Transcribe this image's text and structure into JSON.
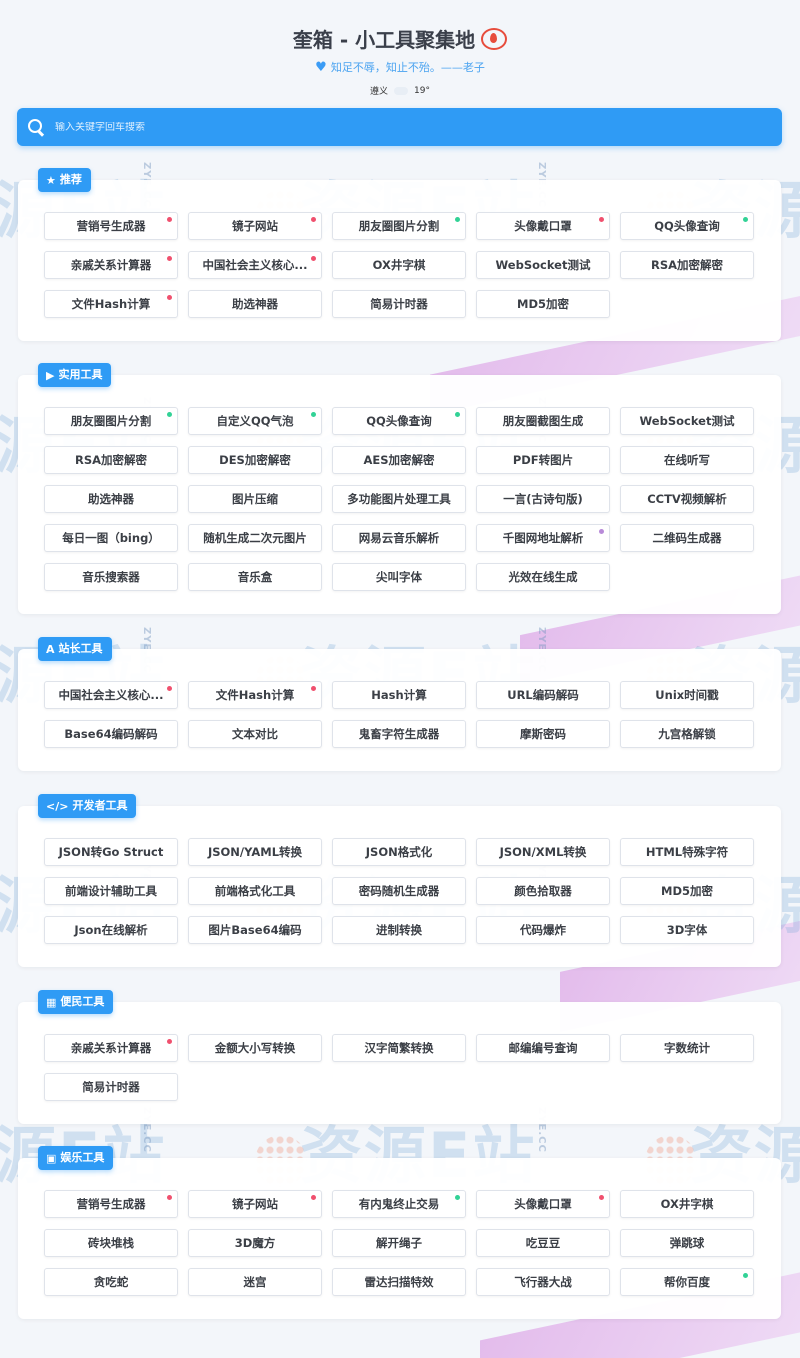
{
  "header": {
    "title": "奎箱 - 小工具聚集地",
    "subtitle": "知足不辱，知止不殆。——老子",
    "weather": {
      "city": "遵义",
      "temp": "19°"
    }
  },
  "search": {
    "placeholder": "输入关键字回车搜索"
  },
  "watermark": {
    "text": "资源E站",
    "small": "ZYE.CC"
  },
  "colors": {
    "accent": "#2f9bf5",
    "red_dot": "#f0506e",
    "green_dot": "#32d296",
    "purple_dot": "#b88ad8"
  },
  "sections": [
    {
      "key": "recommend",
      "title": "推荐",
      "icon": "star-icon",
      "tools": [
        {
          "label": "营销号生成器",
          "dot": "red"
        },
        {
          "label": "镜子网站",
          "dot": "red"
        },
        {
          "label": "朋友圈图片分割",
          "dot": "green"
        },
        {
          "label": "头像戴口罩",
          "dot": "red"
        },
        {
          "label": "QQ头像查询",
          "dot": "green"
        },
        {
          "label": "亲戚关系计算器",
          "dot": "red"
        },
        {
          "label": "中国社会主义核心...",
          "dot": "red"
        },
        {
          "label": "OX井字棋",
          "dot": ""
        },
        {
          "label": "WebSocket测试",
          "dot": ""
        },
        {
          "label": "RSA加密解密",
          "dot": ""
        },
        {
          "label": "文件Hash计算",
          "dot": "red"
        },
        {
          "label": "助选神器",
          "dot": ""
        },
        {
          "label": "简易计时器",
          "dot": ""
        },
        {
          "label": "MD5加密",
          "dot": ""
        }
      ]
    },
    {
      "key": "practical",
      "title": "实用工具",
      "icon": "play-circle-icon",
      "tools": [
        {
          "label": "朋友圈图片分割",
          "dot": "green"
        },
        {
          "label": "自定义QQ气泡",
          "dot": "green"
        },
        {
          "label": "QQ头像查询",
          "dot": "green"
        },
        {
          "label": "朋友圈截图生成",
          "dot": ""
        },
        {
          "label": "WebSocket测试",
          "dot": ""
        },
        {
          "label": "RSA加密解密",
          "dot": ""
        },
        {
          "label": "DES加密解密",
          "dot": ""
        },
        {
          "label": "AES加密解密",
          "dot": ""
        },
        {
          "label": "PDF转图片",
          "dot": ""
        },
        {
          "label": "在线听写",
          "dot": ""
        },
        {
          "label": "助选神器",
          "dot": ""
        },
        {
          "label": "图片压缩",
          "dot": ""
        },
        {
          "label": "多功能图片处理工具",
          "dot": ""
        },
        {
          "label": "一言(古诗句版)",
          "dot": ""
        },
        {
          "label": "CCTV视频解析",
          "dot": ""
        },
        {
          "label": "每日一图（bing）",
          "dot": ""
        },
        {
          "label": "随机生成二次元图片",
          "dot": ""
        },
        {
          "label": "网易云音乐解析",
          "dot": ""
        },
        {
          "label": "千图网地址解析",
          "dot": "purple"
        },
        {
          "label": "二维码生成器",
          "dot": ""
        },
        {
          "label": "音乐搜索器",
          "dot": ""
        },
        {
          "label": "音乐盒",
          "dot": ""
        },
        {
          "label": "尖叫字体",
          "dot": ""
        },
        {
          "label": "光效在线生成",
          "dot": ""
        }
      ]
    },
    {
      "key": "webmaster",
      "title": "站长工具",
      "icon": "font-a-icon",
      "tools": [
        {
          "label": "中国社会主义核心...",
          "dot": "red"
        },
        {
          "label": "文件Hash计算",
          "dot": "red"
        },
        {
          "label": "Hash计算",
          "dot": ""
        },
        {
          "label": "URL编码解码",
          "dot": ""
        },
        {
          "label": "Unix时间戳",
          "dot": ""
        },
        {
          "label": "Base64编码解码",
          "dot": ""
        },
        {
          "label": "文本对比",
          "dot": ""
        },
        {
          "label": "鬼畜字符生成器",
          "dot": ""
        },
        {
          "label": "摩斯密码",
          "dot": ""
        },
        {
          "label": "九宫格解锁",
          "dot": ""
        }
      ]
    },
    {
      "key": "developer",
      "title": "开发者工具",
      "icon": "code-icon",
      "tools": [
        {
          "label": "JSON转Go Struct",
          "dot": ""
        },
        {
          "label": "JSON/YAML转换",
          "dot": ""
        },
        {
          "label": "JSON格式化",
          "dot": ""
        },
        {
          "label": "JSON/XML转换",
          "dot": ""
        },
        {
          "label": "HTML特殊字符",
          "dot": ""
        },
        {
          "label": "前端设计辅助工具",
          "dot": ""
        },
        {
          "label": "前端格式化工具",
          "dot": ""
        },
        {
          "label": "密码随机生成器",
          "dot": ""
        },
        {
          "label": "颜色拾取器",
          "dot": ""
        },
        {
          "label": "MD5加密",
          "dot": ""
        },
        {
          "label": "Json在线解析",
          "dot": ""
        },
        {
          "label": "图片Base64编码",
          "dot": ""
        },
        {
          "label": "进制转换",
          "dot": ""
        },
        {
          "label": "代码爆炸",
          "dot": ""
        },
        {
          "label": "3D字体",
          "dot": ""
        }
      ]
    },
    {
      "key": "convenience",
      "title": "便民工具",
      "icon": "calendar-icon",
      "tools": [
        {
          "label": "亲戚关系计算器",
          "dot": "red"
        },
        {
          "label": "金额大小写转换",
          "dot": ""
        },
        {
          "label": "汉字简繁转换",
          "dot": ""
        },
        {
          "label": "邮编编号查询",
          "dot": ""
        },
        {
          "label": "字数统计",
          "dot": ""
        },
        {
          "label": "简易计时器",
          "dot": ""
        }
      ]
    },
    {
      "key": "entertainment",
      "title": "娱乐工具",
      "icon": "gamepad-icon",
      "tools": [
        {
          "label": "营销号生成器",
          "dot": "red"
        },
        {
          "label": "镜子网站",
          "dot": "red"
        },
        {
          "label": "有内鬼终止交易",
          "dot": "green"
        },
        {
          "label": "头像戴口罩",
          "dot": "red"
        },
        {
          "label": "OX井字棋",
          "dot": ""
        },
        {
          "label": "砖块堆栈",
          "dot": ""
        },
        {
          "label": "3D魔方",
          "dot": ""
        },
        {
          "label": "解开绳子",
          "dot": ""
        },
        {
          "label": "吃豆豆",
          "dot": ""
        },
        {
          "label": "弹跳球",
          "dot": ""
        },
        {
          "label": "贪吃蛇",
          "dot": ""
        },
        {
          "label": "迷宫",
          "dot": ""
        },
        {
          "label": "雷达扫描特效",
          "dot": ""
        },
        {
          "label": "飞行器大战",
          "dot": ""
        },
        {
          "label": "帮你百度",
          "dot": "green"
        }
      ]
    }
  ]
}
